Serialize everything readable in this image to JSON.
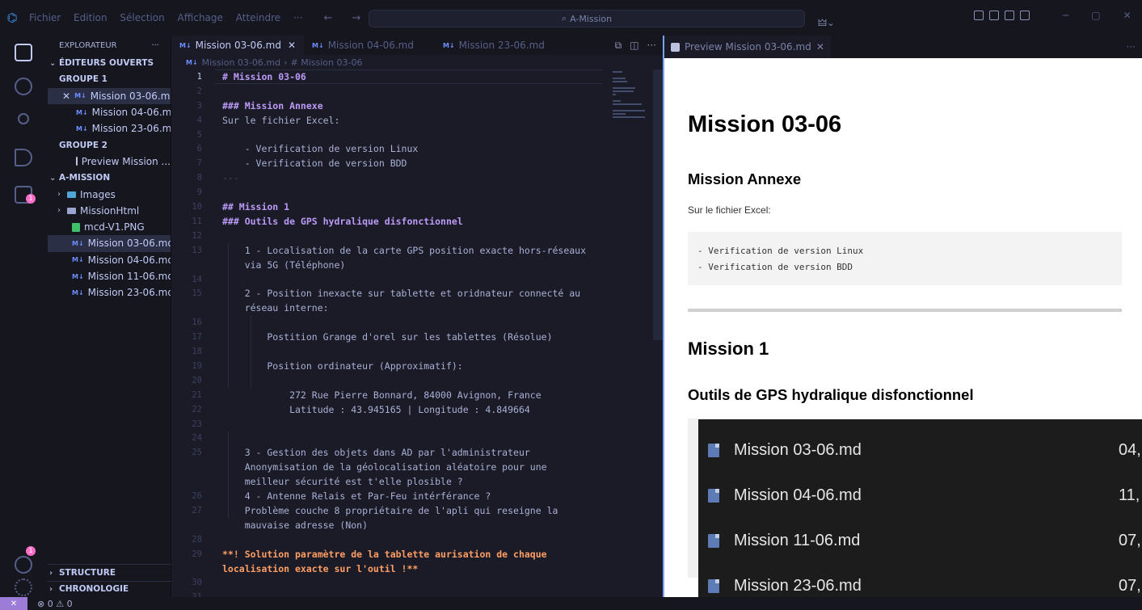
{
  "titlebar": {
    "logo": "⌬",
    "menu": [
      "Fichier",
      "Edition",
      "Sélection",
      "Affichage",
      "Atteindre",
      "···"
    ],
    "nav": "← →",
    "search_text": "A-Mission",
    "copilot": "🜲⌄",
    "window_controls": [
      "─",
      "▢",
      "✕"
    ]
  },
  "activity_bar": {
    "items": [
      "explorer-icon",
      "search-icon",
      "source-control-icon",
      "run-debug-icon",
      "extensions-icon"
    ],
    "extensions_badge": "1",
    "accounts_badge": "1"
  },
  "sidebar": {
    "title": "EXPLORATEUR",
    "more": "···",
    "open_editors_label": "ÉDITEURS OUVERTS",
    "group1_label": "GROUPE 1",
    "group1_files": [
      "Mission 03-06.md",
      "Mission 04-06.md",
      "Mission 23-06.md"
    ],
    "group2_label": "GROUPE 2",
    "group2_files": [
      "Preview Mission ..."
    ],
    "folder_label": "A-MISSION",
    "tree": [
      {
        "name": "Images",
        "kind": "folder"
      },
      {
        "name": "MissionHtml",
        "kind": "folder"
      },
      {
        "name": "mcd-V1.PNG",
        "kind": "image"
      },
      {
        "name": "Mission 03-06.md",
        "kind": "md"
      },
      {
        "name": "Mission 04-06.md",
        "kind": "md"
      },
      {
        "name": "Mission 11-06.md",
        "kind": "md"
      },
      {
        "name": "Mission 23-06.md",
        "kind": "md"
      }
    ],
    "structure_label": "STRUCTURE",
    "chronologie_label": "CHRONOLOGIE"
  },
  "editor": {
    "tabs": [
      {
        "label": "Mission 03-06.md",
        "active": true,
        "close": "✕"
      },
      {
        "label": "Mission 04-06.md",
        "active": false
      },
      {
        "label": "Mission 23-06.md",
        "active": false
      }
    ],
    "md_badge": "M↓",
    "breadcrumb": [
      "Mission 03-06.md",
      "# Mission 03-06"
    ],
    "breadcrumb_sep": "›",
    "lines": [
      {
        "n": "1",
        "t": "# Mission 03-06",
        "c": "h1"
      },
      {
        "n": "2",
        "t": "",
        "c": ""
      },
      {
        "n": "3",
        "t": "### Mission Annexe",
        "c": "h3"
      },
      {
        "n": "4",
        "t": "Sur le fichier Excel:",
        "c": ""
      },
      {
        "n": "5",
        "t": "",
        "c": ""
      },
      {
        "n": "6",
        "t": "    - Verification de version Linux",
        "c": ""
      },
      {
        "n": "7",
        "t": "    - Verification de version BDD",
        "c": ""
      },
      {
        "n": "8",
        "t": "---",
        "c": "hr"
      },
      {
        "n": "9",
        "t": "",
        "c": ""
      },
      {
        "n": "10",
        "t": "## Mission 1",
        "c": "h3"
      },
      {
        "n": "11",
        "t": "### Outils de GPS hydralique disfonctionnel",
        "c": "h3"
      },
      {
        "n": "12",
        "t": "",
        "c": ""
      },
      {
        "n": "13",
        "t": "    1 - Localisation de la carte GPS position exacte hors-réseaux",
        "c": ""
      },
      {
        "n": "",
        "t": "    via 5G (Téléphone)",
        "c": ""
      },
      {
        "n": "14",
        "t": "",
        "c": ""
      },
      {
        "n": "15",
        "t": "    2 - Position inexacte sur tablette et oridnateur connecté au",
        "c": ""
      },
      {
        "n": "",
        "t": "    réseau interne:",
        "c": ""
      },
      {
        "n": "16",
        "t": "",
        "c": ""
      },
      {
        "n": "17",
        "t": "        Postition Grange d'orel sur les tablettes (Résolue)",
        "c": ""
      },
      {
        "n": "18",
        "t": "",
        "c": ""
      },
      {
        "n": "19",
        "t": "        Position ordinateur (Approximatif):",
        "c": ""
      },
      {
        "n": "20",
        "t": "",
        "c": ""
      },
      {
        "n": "21",
        "t": "            272 Rue Pierre Bonnard, 84000 Avignon, France",
        "c": ""
      },
      {
        "n": "22",
        "t": "            Latitude : 43.945165 | Longitude : 4.849664",
        "c": ""
      },
      {
        "n": "23",
        "t": "",
        "c": ""
      },
      {
        "n": "24",
        "t": "",
        "c": ""
      },
      {
        "n": "25",
        "t": "    3 - Gestion des objets dans AD par l'administrateur",
        "c": ""
      },
      {
        "n": "",
        "t": "    Anonymisation de la géolocalisation aléatoire pour une",
        "c": ""
      },
      {
        "n": "",
        "t": "    meilleur sécurité est t'elle plosible ?",
        "c": ""
      },
      {
        "n": "26",
        "t": "    4 - Antenne Relais et Par-Feu intérférance ?",
        "c": ""
      },
      {
        "n": "27",
        "t": "    Problème couche 8 propriétaire de l'apli qui reseigne la",
        "c": ""
      },
      {
        "n": "",
        "t": "    mauvaise adresse (Non)",
        "c": ""
      },
      {
        "n": "28",
        "t": "",
        "c": ""
      },
      {
        "n": "29",
        "t": "**! Solution paramètre de la tablette aurisation de chaque",
        "c": "bold"
      },
      {
        "n": "",
        "t": "localisation exacte sur l'outil !**",
        "c": "bold"
      },
      {
        "n": "30",
        "t": "",
        "c": ""
      },
      {
        "n": "31",
        "t": "---",
        "c": "hr"
      }
    ]
  },
  "preview": {
    "tab_label": "Preview Mission 03-06.md",
    "tab_close": "✕",
    "more": "···",
    "h1": "Mission 03-06",
    "h3_annexe": "Mission Annexe",
    "p_excel": "Sur le fichier Excel:",
    "code": "- Verification de version Linux\n- Verification de version BDD",
    "h2_mission1": "Mission 1",
    "h3_outils": "Outils de GPS hydralique disfonctionnel",
    "image_rows": [
      {
        "name": "Mission 03-06.md",
        "date": "04,"
      },
      {
        "name": "Mission 04-06.md",
        "date": "11,"
      },
      {
        "name": "Mission 11-06.md",
        "date": "07,"
      },
      {
        "name": "Mission 23-06.md",
        "date": "07,"
      }
    ]
  },
  "statusbar": {
    "remote": "✕",
    "problems": "⊗ 0 ⚠ 0"
  }
}
